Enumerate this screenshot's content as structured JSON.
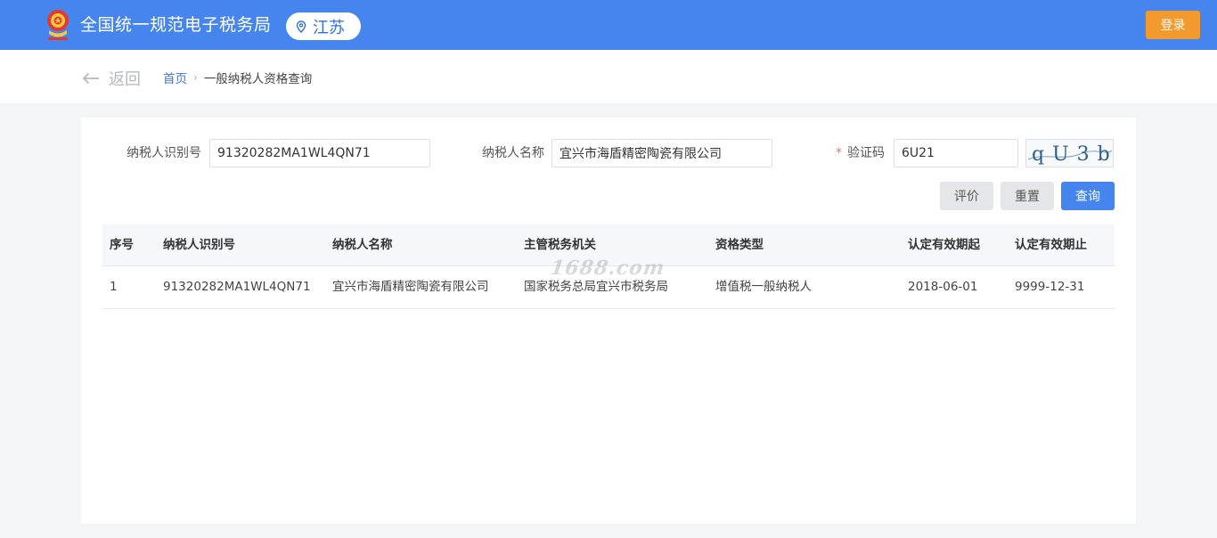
{
  "header": {
    "title": "全国统一规范电子税务局",
    "region": "江苏",
    "login_label": "登录",
    "colors": {
      "bar": "#4684ee",
      "login": "#f39a2e"
    }
  },
  "nav": {
    "back_label": "返回",
    "breadcrumb_home": "首页",
    "breadcrumb_separator": "›",
    "breadcrumb_current": "一般纳税人资格查询"
  },
  "form": {
    "taxpayer_id_label": "纳税人识别号",
    "taxpayer_id_value": "91320282MA1WL4QN71",
    "taxpayer_name_label": "纳税人名称",
    "taxpayer_name_value": "宜兴市海盾精密陶瓷有限公司",
    "required_mark": "*",
    "captcha_label": "验证码",
    "captcha_value": "6U21",
    "captcha_image_text": "qU3b"
  },
  "buttons": {
    "rate": "评价",
    "reset": "重置",
    "query": "查询"
  },
  "table": {
    "columns": [
      "序号",
      "纳税人识别号",
      "纳税人名称",
      "主管税务机关",
      "资格类型",
      "认定有效期起",
      "认定有效期止"
    ],
    "rows": [
      [
        "1",
        "91320282MA1WL4QN71",
        "宜兴市海盾精密陶瓷有限公司",
        "国家税务总局宜兴市税务局",
        "增值税一般纳税人",
        "2018-06-01",
        "9999-12-31"
      ]
    ]
  },
  "watermark": "1688.com"
}
